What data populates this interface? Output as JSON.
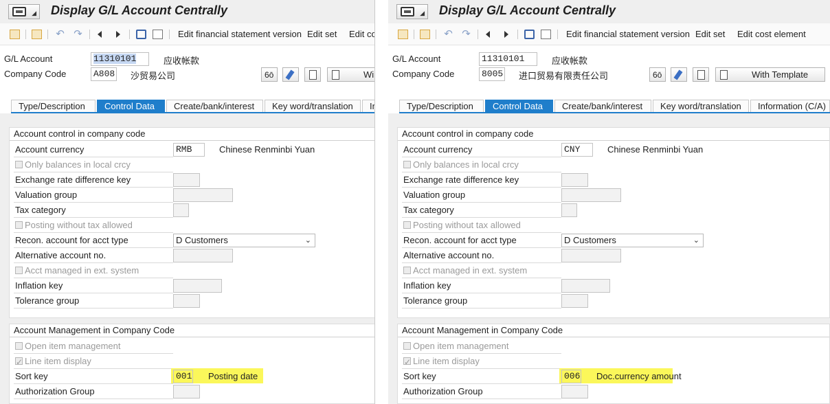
{
  "left": {
    "title": "Display G/L Account Centrally",
    "toolbar": {
      "edit_fsv": "Edit financial statement version",
      "edit_set": "Edit set",
      "edit_cost": "Edit co"
    },
    "header": {
      "gl_label": "G/L Account",
      "gl_value": "11310101",
      "gl_desc": "应收帐款",
      "cc_label": "Company Code",
      "cc_value": "A808",
      "cc_desc": "沙贸易公司",
      "template_label": "Wi"
    },
    "tabs": [
      "Type/Description",
      "Control Data",
      "Create/bank/interest",
      "Key word/translation",
      "In"
    ],
    "group1": {
      "title": "Account control in company code",
      "account_currency": {
        "label": "Account currency",
        "value": "RMB",
        "desc": "Chinese Renminbi Yuan"
      },
      "only_balances": "Only balances in local crcy",
      "exch_rate_key": "Exchange rate difference key",
      "valuation_group": "Valuation group",
      "tax_category": "Tax category",
      "posting_wo_tax": "Posting without tax allowed",
      "recon": {
        "label": "Recon. account for acct type",
        "value": "D Customers"
      },
      "alt_account": "Alternative account no.",
      "acct_ext": "Acct managed in ext. system",
      "inflation_key": "Inflation key",
      "tolerance_group": "Tolerance group"
    },
    "group2": {
      "title": "Account Management in Company Code",
      "open_item": "Open item management",
      "line_item": "Line item display",
      "sort_key": {
        "label": "Sort key",
        "value": "001",
        "desc": "Posting date"
      },
      "auth_group": "Authorization Group"
    }
  },
  "right": {
    "title": "Display G/L Account Centrally",
    "toolbar": {
      "edit_fsv": "Edit financial statement version",
      "edit_set": "Edit set",
      "edit_cost": "Edit cost element"
    },
    "header": {
      "gl_label": "G/L Account",
      "gl_value": "11310101",
      "gl_desc": "应收帐款",
      "cc_label": "Company Code",
      "cc_value": "8005",
      "cc_desc": "进口贸易有限责任公司",
      "template_label": "With Template"
    },
    "tabs": [
      "Type/Description",
      "Control Data",
      "Create/bank/interest",
      "Key word/translation",
      "Information (C/A)"
    ],
    "group1": {
      "title": "Account control in company code",
      "account_currency": {
        "label": "Account currency",
        "value": "CNY",
        "desc": "Chinese Renminbi Yuan"
      },
      "only_balances": "Only balances in local crcy",
      "exch_rate_key": "Exchange rate difference key",
      "valuation_group": "Valuation group",
      "tax_category": "Tax category",
      "posting_wo_tax": "Posting without tax allowed",
      "recon": {
        "label": "Recon. account for acct type",
        "value": "D Customers"
      },
      "alt_account": "Alternative account no.",
      "acct_ext": "Acct managed in ext. system",
      "inflation_key": "Inflation key",
      "tolerance_group": "Tolerance group"
    },
    "group2": {
      "title": "Account Management in Company Code",
      "open_item": "Open item management",
      "line_item": "Line item display",
      "sort_key": {
        "label": "Sort key",
        "value": "006",
        "desc": "Doc.currency amount"
      },
      "auth_group": "Authorization Group"
    }
  },
  "colors": {
    "tab_active": "#1f7ecb",
    "highlight": "#fbf75a",
    "selection": "#c6d8f3"
  }
}
